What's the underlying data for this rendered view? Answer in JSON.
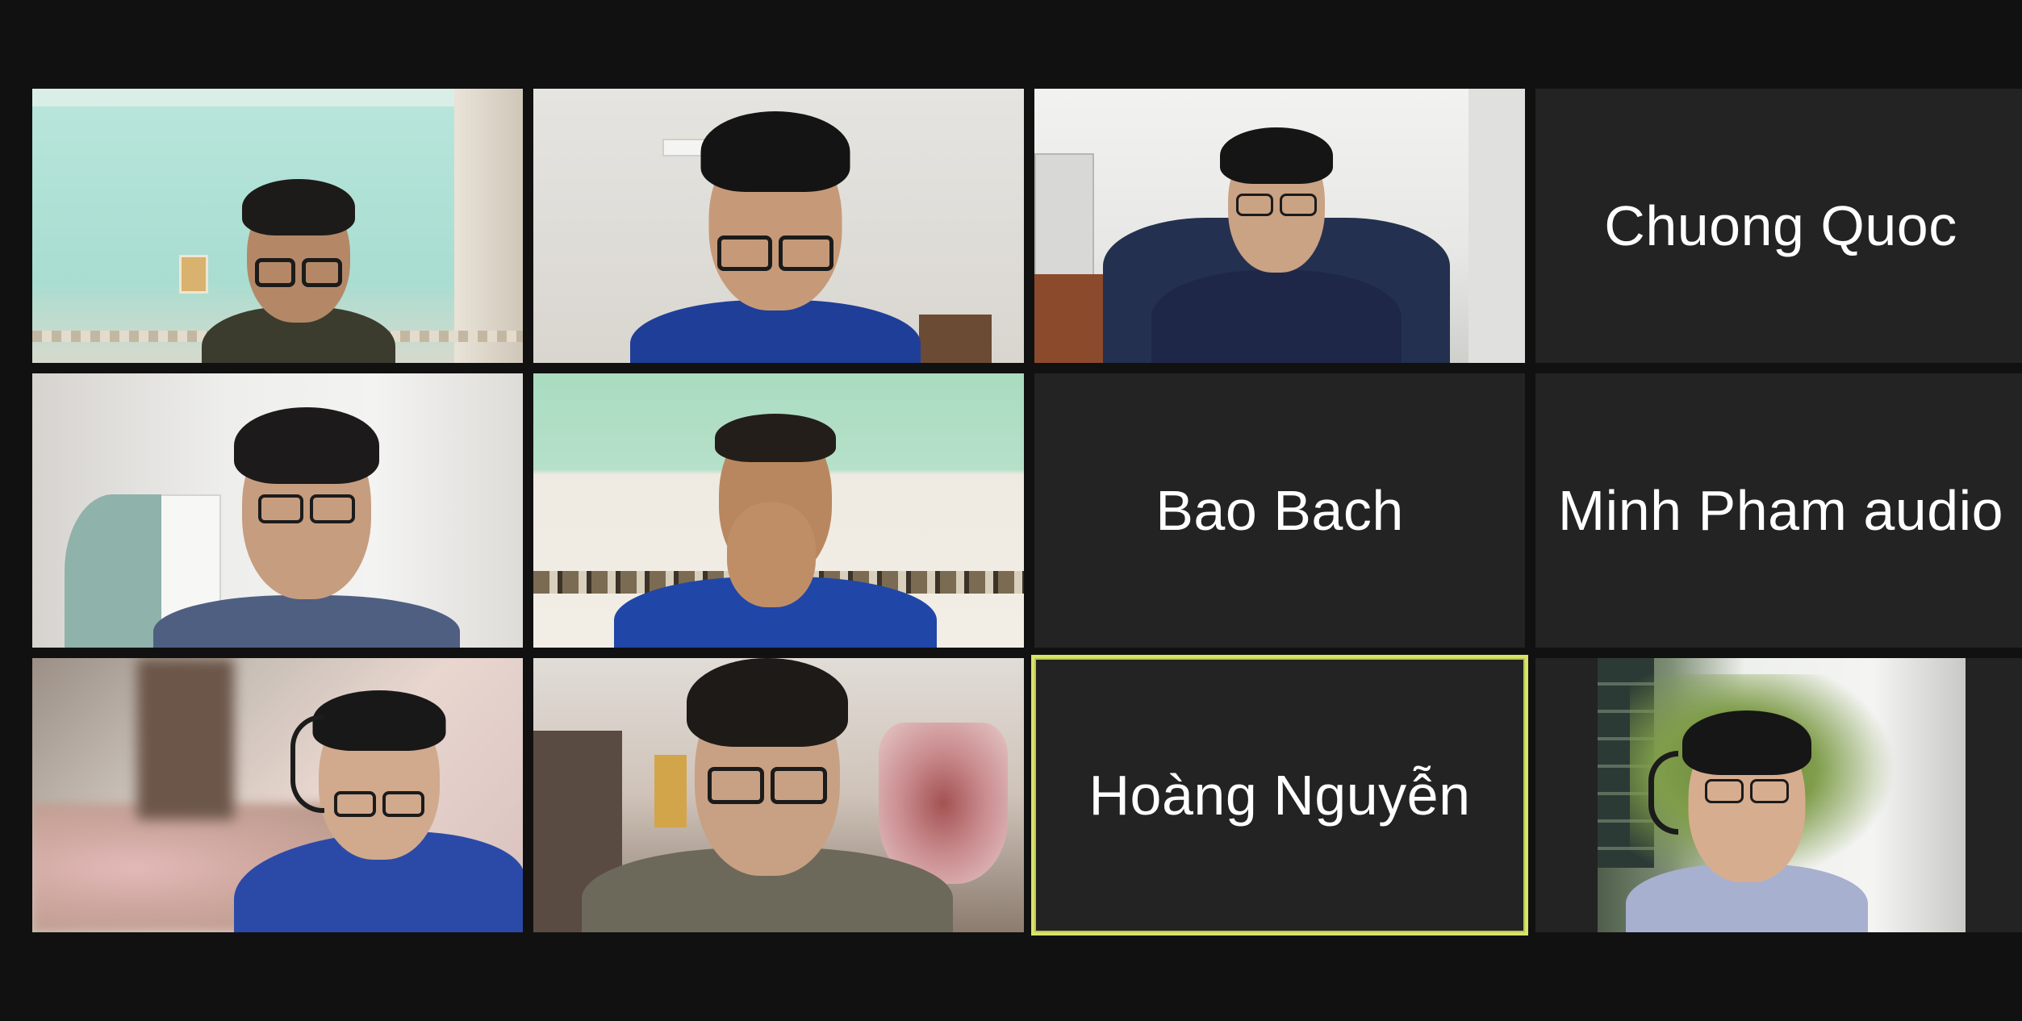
{
  "participants": [
    {
      "type": "video",
      "icon": "participant-video"
    },
    {
      "type": "video",
      "icon": "participant-video"
    },
    {
      "type": "video",
      "icon": "participant-video"
    },
    {
      "type": "name",
      "name": "Chuong Quoc"
    },
    {
      "type": "video",
      "icon": "participant-video"
    },
    {
      "type": "video",
      "icon": "participant-video"
    },
    {
      "type": "name",
      "name": "Bao Bach"
    },
    {
      "type": "name",
      "name": "Minh Pham audio"
    },
    {
      "type": "video",
      "icon": "participant-video"
    },
    {
      "type": "video",
      "icon": "participant-video"
    },
    {
      "type": "name",
      "name": "Hoàng Nguyễn",
      "active_speaker": true
    },
    {
      "type": "video",
      "icon": "participant-video"
    }
  ],
  "colors": {
    "background": "#111111",
    "tile": "#232323",
    "active_border": "#d9e36a",
    "name_text": "#ffffff"
  }
}
